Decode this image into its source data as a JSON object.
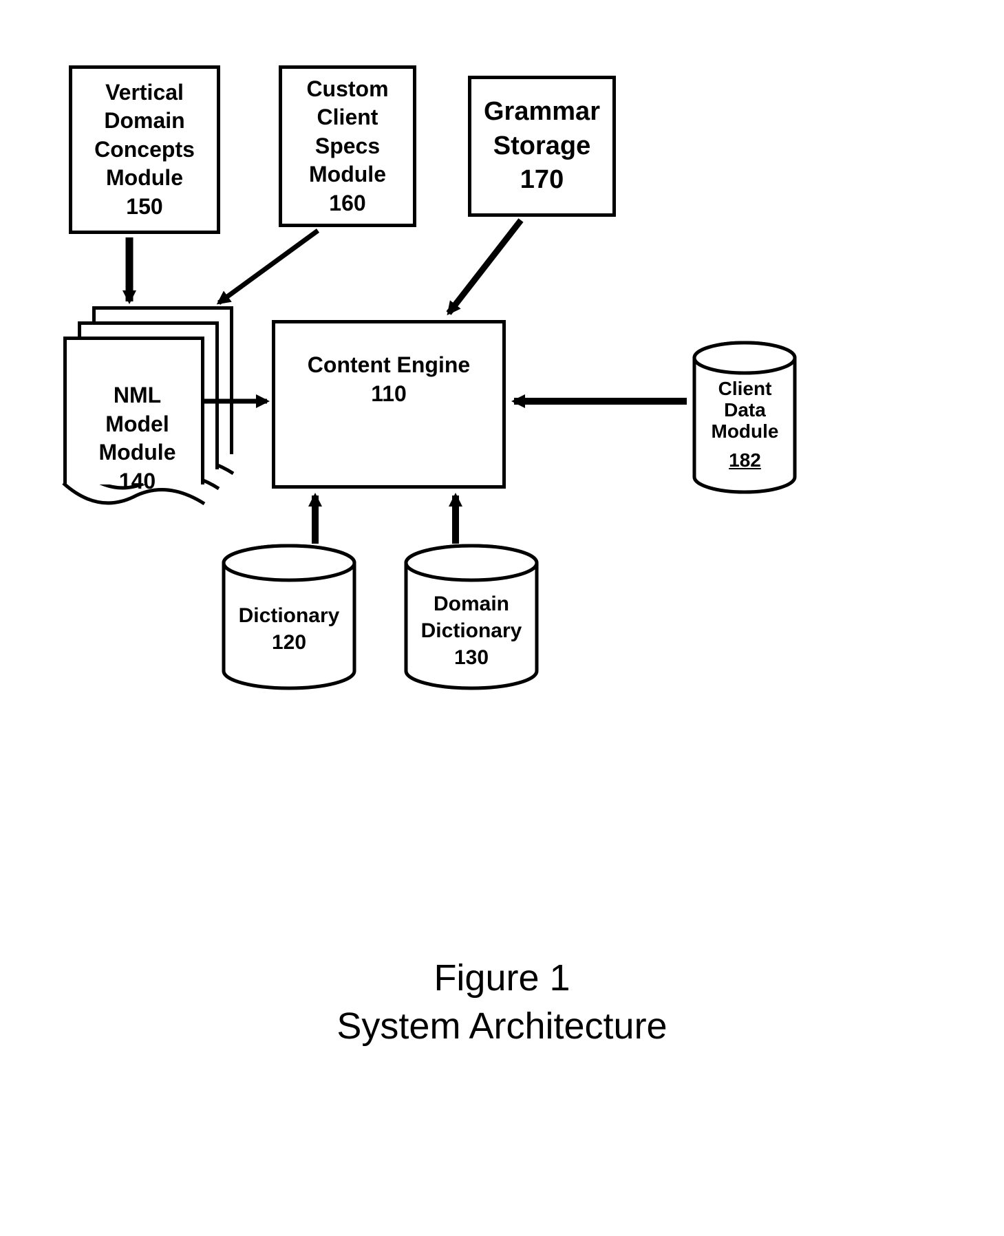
{
  "boxes": {
    "b150": {
      "l1": "Vertical",
      "l2": "Domain",
      "l3": "Concepts",
      "l4": "Module",
      "l5": "150"
    },
    "b160": {
      "l1": "Custom",
      "l2": "Client",
      "l3": "Specs",
      "l4": "Module",
      "l5": "160"
    },
    "b170": {
      "l1": "Grammar",
      "l2": "Storage",
      "l3": "170"
    },
    "b110": {
      "l1": "Content Engine",
      "l2": "110"
    },
    "b140": {
      "l1": "NML",
      "l2": "Model",
      "l3": "Module",
      "l4": "140"
    }
  },
  "cyls": {
    "c120": {
      "l1": "Dictionary",
      "l2": "120"
    },
    "c130": {
      "l1": "Domain",
      "l2": "Dictionary",
      "l3": "130"
    },
    "c182": {
      "l1": "Client",
      "l2": "Data",
      "l3": "Module",
      "l4": "182"
    }
  },
  "caption": {
    "line1": "Figure 1",
    "line2": "System Architecture"
  }
}
